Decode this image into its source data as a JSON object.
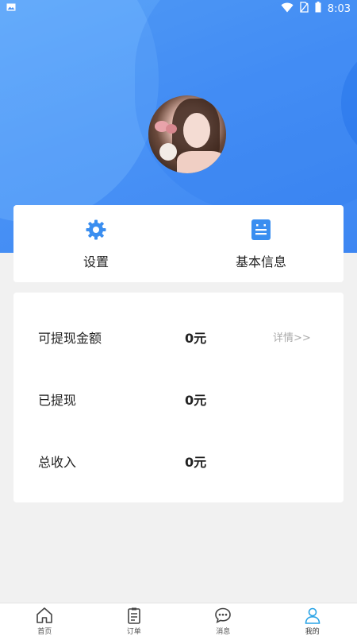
{
  "status_bar": {
    "time": "8:03",
    "icons": [
      "image-icon",
      "wifi-icon",
      "no-sim-icon",
      "battery-icon"
    ]
  },
  "profile": {
    "avatar": "user-avatar-photo"
  },
  "quick_actions": [
    {
      "label": "设置",
      "icon": "gear-icon"
    },
    {
      "label": "基本信息",
      "icon": "info-card-icon"
    }
  ],
  "earnings": {
    "rows": [
      {
        "label": "可提现金额",
        "value": "0元",
        "link": "详情>>"
      },
      {
        "label": "已提现",
        "value": "0元"
      },
      {
        "label": "总收入",
        "value": "0元"
      }
    ]
  },
  "tabbar": {
    "items": [
      {
        "label": "首页",
        "icon": "home-icon"
      },
      {
        "label": "订单",
        "icon": "clipboard-icon"
      },
      {
        "label": "消息",
        "icon": "chat-icon"
      },
      {
        "label": "我的",
        "icon": "person-icon",
        "active": true
      }
    ]
  },
  "colors": {
    "accent": "#4a93f6",
    "icon_blue": "#3a8ef0",
    "tab_active": "#29a3e6"
  }
}
